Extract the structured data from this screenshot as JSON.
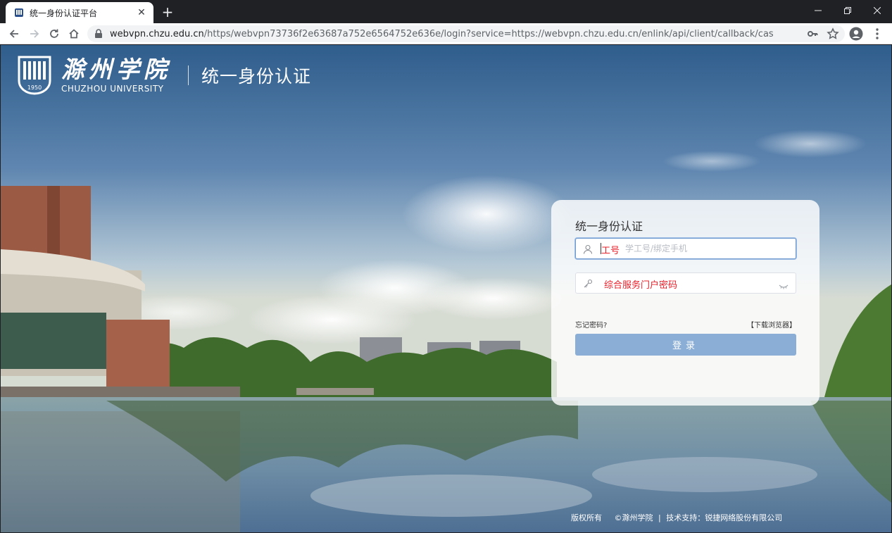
{
  "browser": {
    "tab_title": "统一身份认证平台",
    "new_tab_label": "+",
    "url_host": "webvpn.chzu.edu.cn",
    "url_path": "/https/webvpn73736f2e63687a752e6564752e636e/login?service=https://webvpn.chzu.edu.cn/enlink/api/client/callback/cas"
  },
  "header": {
    "school_name_cn": "滁州学院",
    "school_name_en": "CHUZHOU UNIVERSITY",
    "seal_year": "1950",
    "system_title": "统一身份认证"
  },
  "login": {
    "title": "统一身份认证",
    "username_placeholder": "学工号/绑定手机",
    "username_hint": "工号",
    "password_hint": "综合服务门户密码",
    "forgot_label": "忘记密码?",
    "download_label": "【下载浏览器】",
    "submit_label": "登录"
  },
  "footer": {
    "copyright": "版权所有",
    "owner": "©滁州学院",
    "separator": "|",
    "support": "技术支持：锐捷网络股份有限公司"
  },
  "colors": {
    "sky_top": "#2f5f8f",
    "button": "#8aaed6",
    "hint_red": "#e8202a"
  }
}
